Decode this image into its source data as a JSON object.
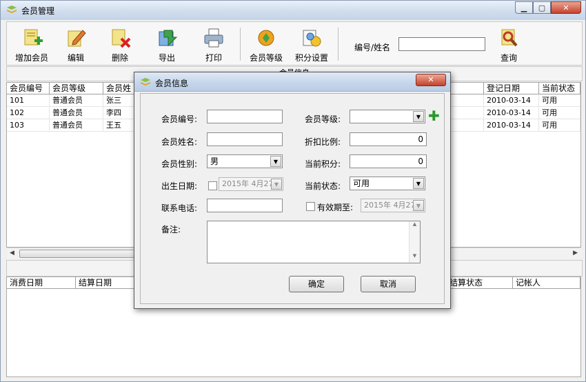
{
  "window": {
    "title": "会员管理"
  },
  "toolbar": {
    "add": "增加会员",
    "edit": "编辑",
    "delete": "删除",
    "export": "导出",
    "print": "打印",
    "level": "会员等级",
    "points": "积分设置",
    "search_label": "编号/姓名",
    "search_value": "",
    "query": "查询"
  },
  "members": {
    "section_title": "会员信息",
    "columns": [
      "会员编号",
      "会员等级",
      "会员姓",
      "登记日期",
      "当前状态"
    ],
    "rows": [
      {
        "id": "101",
        "level": "普通会员",
        "name": "张三",
        "date": "2010-03-14",
        "status": "可用"
      },
      {
        "id": "102",
        "level": "普通会员",
        "name": "李四",
        "date": "2010-03-14",
        "status": "可用"
      },
      {
        "id": "103",
        "level": "普通会员",
        "name": "王五",
        "date": "2010-03-14",
        "status": "可用"
      }
    ]
  },
  "consumption": {
    "columns": [
      "消费日期",
      "结算日期",
      "结算状态",
      "记帐人"
    ]
  },
  "dialog": {
    "title": "会员信息",
    "labels": {
      "member_id": "会员编号:",
      "member_level": "会员等级:",
      "member_name": "会员姓名:",
      "discount": "折扣比例:",
      "gender": "会员性别:",
      "points": "当前积分:",
      "birthday": "出生日期:",
      "status": "当前状态:",
      "phone": "联系电话:",
      "expiry": "有效期至:",
      "remark": "备注:"
    },
    "values": {
      "member_id": "",
      "member_level": "",
      "member_name": "",
      "discount": "0",
      "gender": "男",
      "points": "0",
      "birthday": "2015年 4月27",
      "status": "可用",
      "phone": "",
      "expiry": "2015年 4月27",
      "remark": ""
    },
    "ok": "确定",
    "cancel": "取消"
  },
  "colors": {
    "title_gradient_top": "#e8f0fa",
    "close_red": "#c7422c",
    "plus_green": "#2a9a2a"
  }
}
